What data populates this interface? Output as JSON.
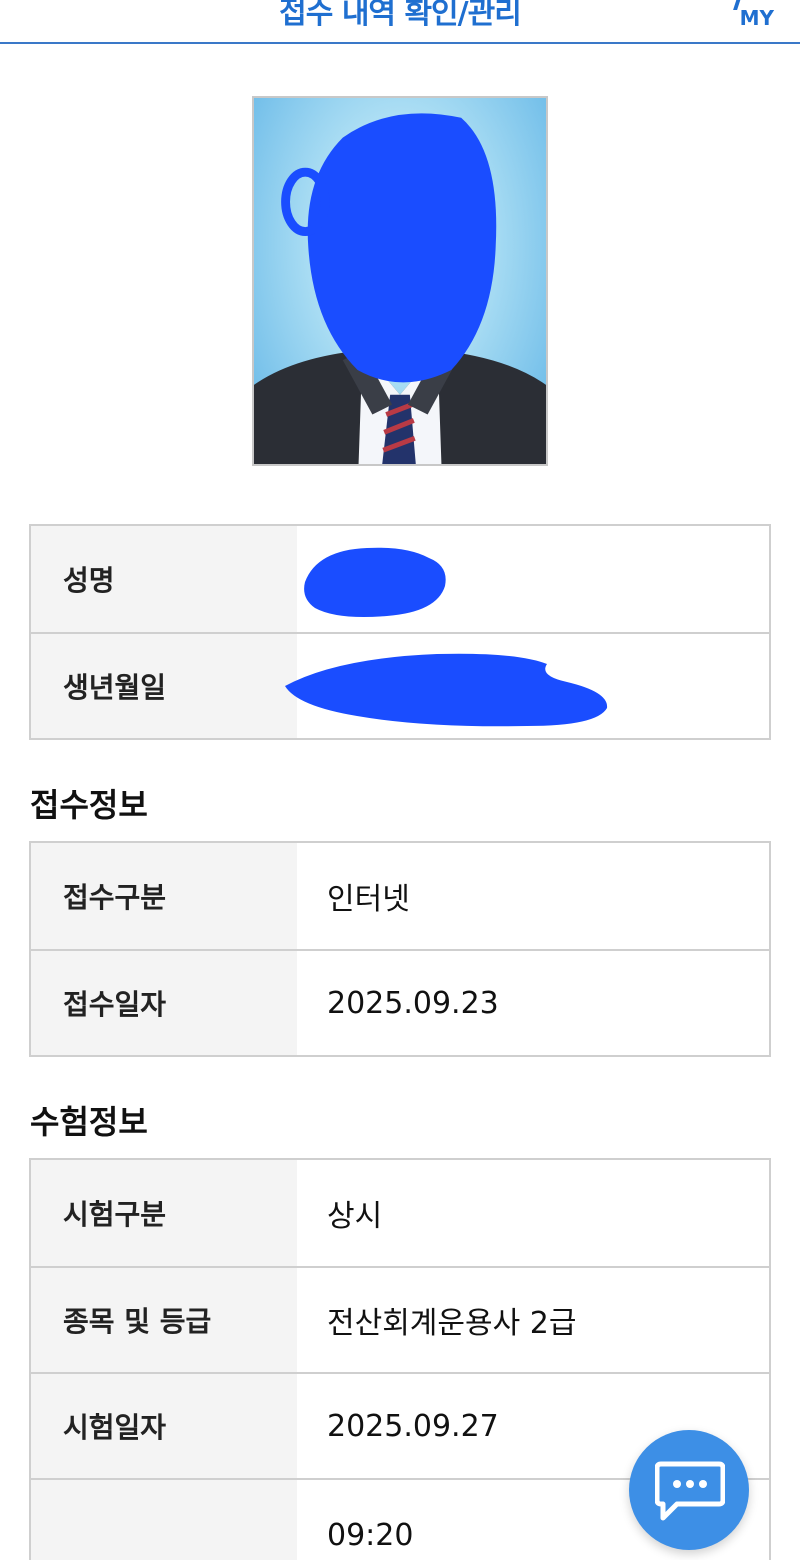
{
  "header": {
    "title": "접수 내역 확인/관리",
    "my_label": "MY"
  },
  "profile": {
    "name_label": "성명",
    "birth_label": "생년월일"
  },
  "reception": {
    "section_title": "접수정보",
    "rows": [
      {
        "label": "접수구분",
        "value": "인터넷"
      },
      {
        "label": "접수일자",
        "value": "2025.09.23"
      }
    ]
  },
  "exam": {
    "section_title": "수험정보",
    "rows": [
      {
        "label": "시험구분",
        "value": "상시"
      },
      {
        "label": "종목 및 등급",
        "value": "전산회계운용사 2급"
      },
      {
        "label": "시험일자",
        "value": "2025.09.27"
      },
      {
        "label": "",
        "value": "09:20"
      }
    ]
  },
  "colors": {
    "accent": "#1f6fd0",
    "redaction": "#1a4dff",
    "chat_button": "#3d8fe6"
  },
  "icons": [
    "menu-icon",
    "user-icon",
    "chat-icon"
  ]
}
